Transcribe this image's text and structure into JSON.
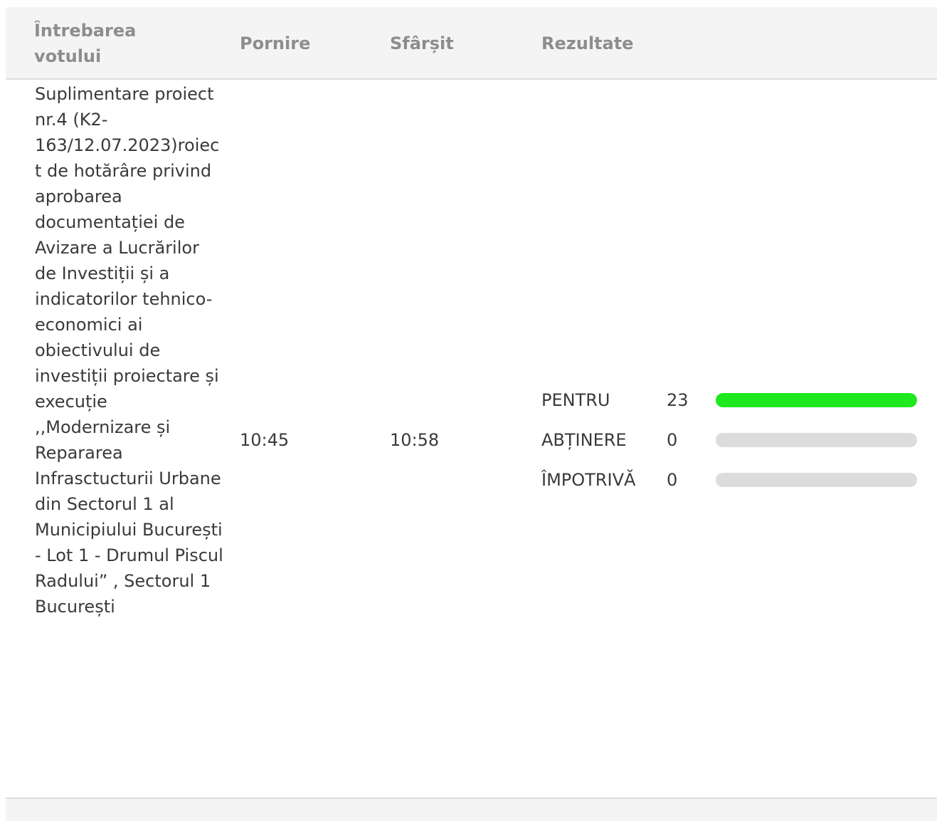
{
  "table": {
    "headers": {
      "question": "Întrebarea votului",
      "start": "Pornire",
      "end": "Sfârșit",
      "results": "Rezultate"
    },
    "rows": [
      {
        "question": "Suplimentare proiect nr.4 (K2-163/12.07.2023)roiect de hotărâre privind aprobarea documentației de Avizare a Lucrărilor de Investiții și a indicatorilor tehnico-economici ai obiectivului de investiții proiectare și execuție ,,Modernizare și Repararea Infrasctucturii Urbane din Sectorul 1 al Municipiului București - Lot 1 - Drumul Piscul Radului” , Sectorul 1 București",
        "start": "10:45",
        "end": "10:58",
        "results": [
          {
            "label": "PENTRU",
            "count": "23",
            "share": 1.0,
            "color": "#1ee81e"
          },
          {
            "label": "ABȚINERE",
            "count": "0",
            "share": 0.0,
            "color": "#1ee81e"
          },
          {
            "label": "ÎMPOTRIVĂ",
            "count": "0",
            "share": 0.0,
            "color": "#1ee81e"
          }
        ]
      }
    ]
  },
  "colors": {
    "header_bg": "#f4f4f4",
    "header_text": "#8d8d8d",
    "bar_track": "#dcdcdc",
    "bar_fill_for": "#1ee81e"
  }
}
